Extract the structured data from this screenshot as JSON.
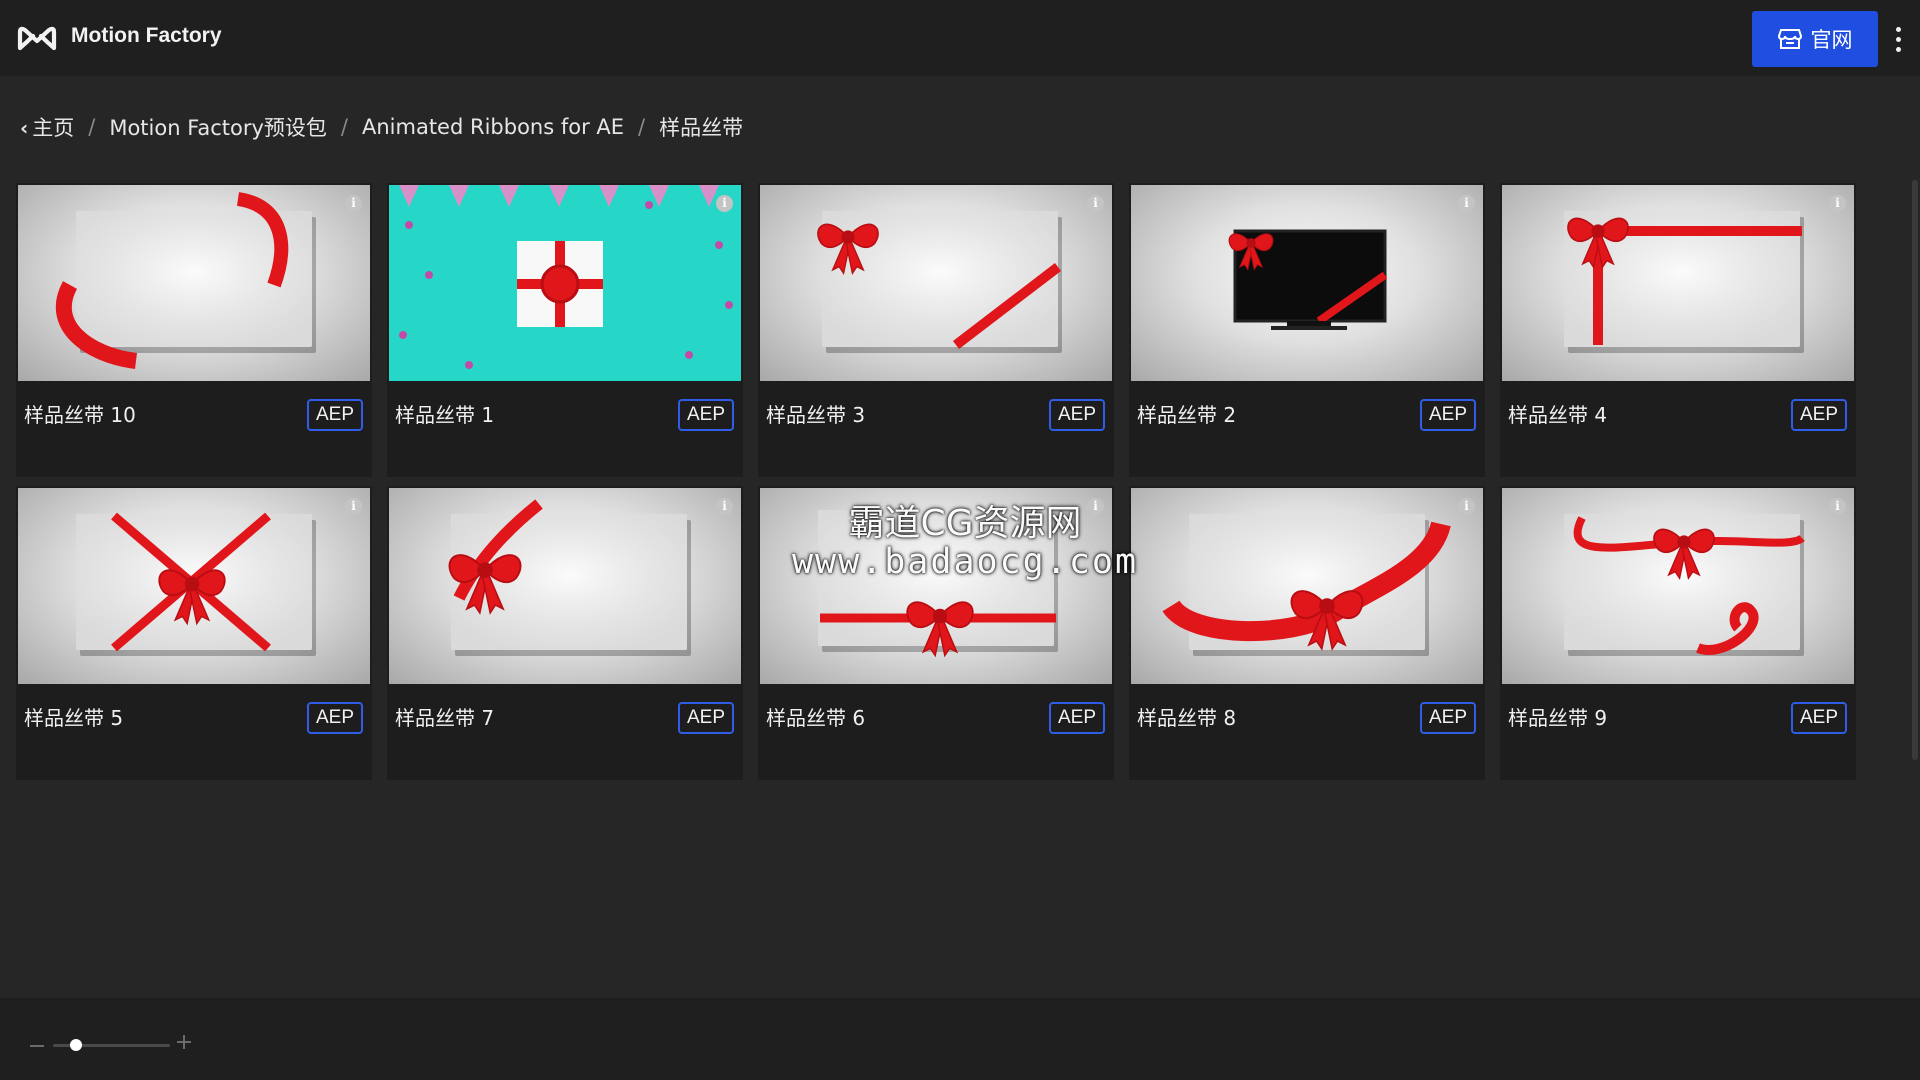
{
  "app": {
    "title": "Motion Factory",
    "site_button_label": "官网",
    "accent_color": "#1f4ee0"
  },
  "breadcrumb": {
    "items": [
      "主页",
      "Motion Factory预设包",
      "Animated Ribbons for AE",
      "样品丝带"
    ],
    "separator": "/"
  },
  "cards": [
    {
      "title": "样品丝带 10",
      "badge": "AEP",
      "thumb": "corner-ribbon"
    },
    {
      "title": "样品丝带 1",
      "badge": "AEP",
      "thumb": "gift-box-teal"
    },
    {
      "title": "样品丝带 3",
      "badge": "AEP",
      "thumb": "bow-top-left-diagonal"
    },
    {
      "title": "样品丝带 2",
      "badge": "AEP",
      "thumb": "tv-bow"
    },
    {
      "title": "样品丝带 4",
      "badge": "AEP",
      "thumb": "bow-cross-corner"
    },
    {
      "title": "样品丝带 5",
      "badge": "AEP",
      "thumb": "bow-x-center"
    },
    {
      "title": "样品丝带 7",
      "badge": "AEP",
      "thumb": "bow-left-corner"
    },
    {
      "title": "样品丝带 6",
      "badge": "AEP",
      "thumb": "bow-bottom-band"
    },
    {
      "title": "样品丝带 8",
      "badge": "AEP",
      "thumb": "ribbon-wrap-bow"
    },
    {
      "title": "样品丝带 9",
      "badge": "AEP",
      "thumb": "bow-top-curl"
    }
  ],
  "watermark": {
    "line1": "霸道CG资源网",
    "line2": "www.badaocg.com"
  },
  "zoom": {
    "minus": "−",
    "plus": "+",
    "value_fraction": 0.2
  }
}
